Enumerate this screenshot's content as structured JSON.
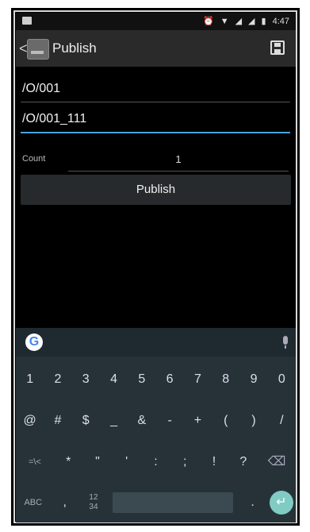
{
  "status_bar": {
    "time": "4:47",
    "icons": [
      "alarm-icon",
      "wifi-icon",
      "signal-icon",
      "signal-icon",
      "battery-icon"
    ]
  },
  "action_bar": {
    "title": "Publish",
    "back_glyph": "<",
    "save_icon": "save-icon"
  },
  "form": {
    "topic_field_1": "/O/001",
    "topic_field_2": "/O/001_111",
    "count_label": "Count",
    "count_value": "1",
    "publish_label": "Publish"
  },
  "keyboard": {
    "row_numbers": [
      "1",
      "2",
      "3",
      "4",
      "5",
      "6",
      "7",
      "8",
      "9",
      "0"
    ],
    "row_symbols_1": [
      "@",
      "#",
      "$",
      "_",
      "&",
      "-",
      "+",
      "(",
      ")",
      "/"
    ],
    "row_symbols_2": [
      "=\\<",
      "*",
      "\"",
      "'",
      ":",
      ";",
      "!",
      "?"
    ],
    "row_bottom": {
      "abc": "ABC",
      "comma": ",",
      "fraction_top": "12",
      "fraction_bottom": "34",
      "period": "."
    },
    "backspace_glyph": "⌫",
    "enter_glyph": "↵",
    "google_glyph": "G"
  }
}
